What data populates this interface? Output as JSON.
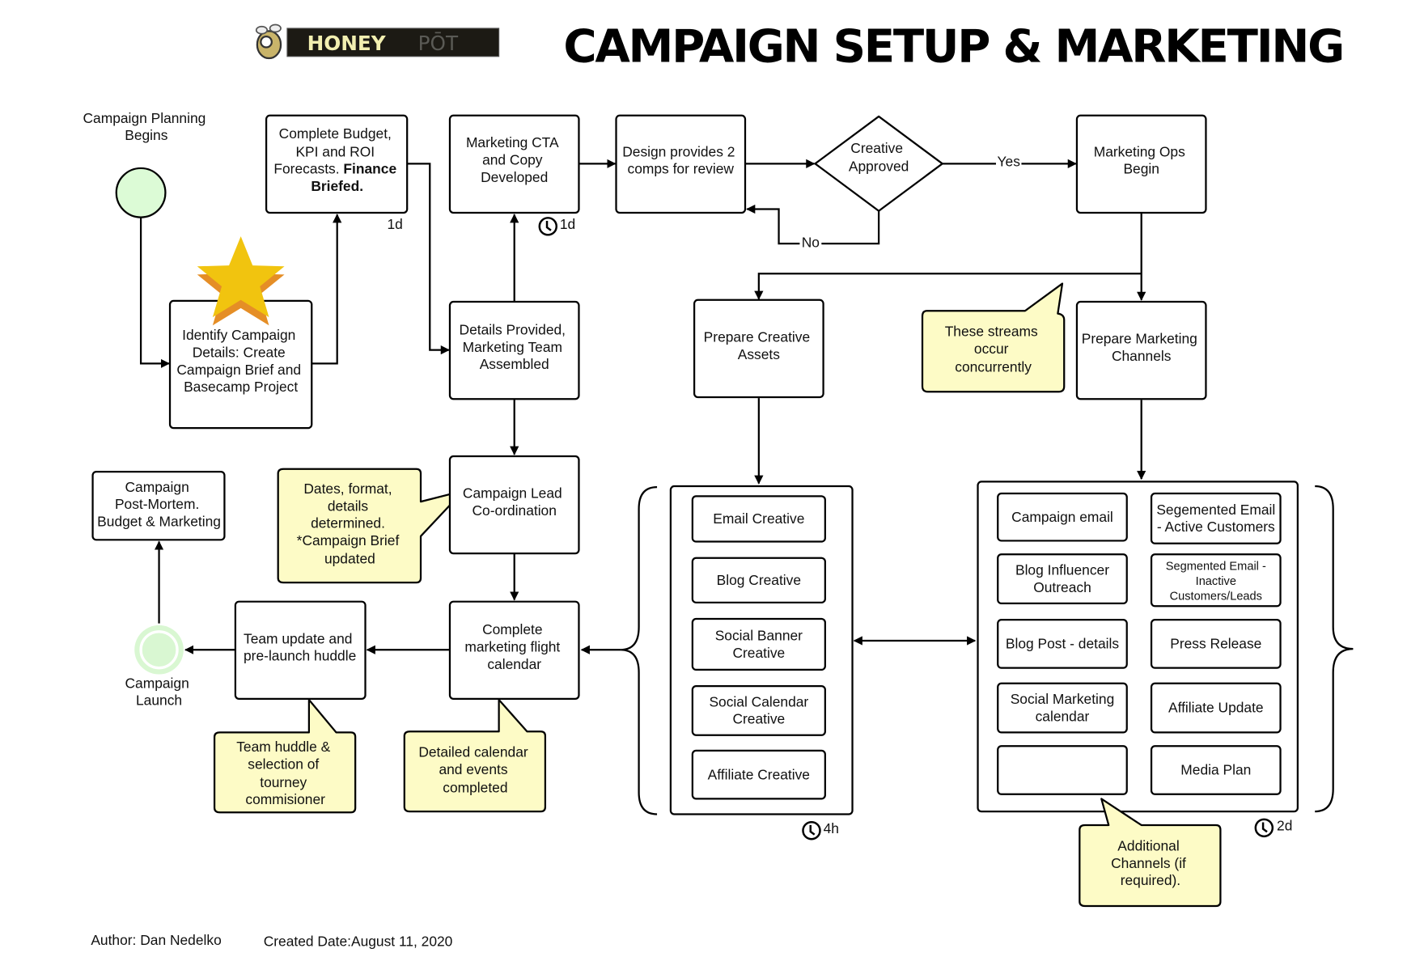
{
  "header": {
    "logo_text_bold": "HONEY",
    "logo_text_light": "PŌT",
    "title": "CAMPAIGN SETUP & MARKETING"
  },
  "colors": {
    "note_fill": "#fdfbc6",
    "start_circle_fill": "#dcfbd6",
    "end_circle_fill": "#d9f7d2",
    "star_fill": "#f1c40f",
    "star_shadow": "#e58e26"
  },
  "nodes": {
    "start": {
      "label": [
        "Campaign Planning",
        "Begins"
      ],
      "icon": "start-circle"
    },
    "identify": {
      "label": [
        "Identify Campaign",
        "Details: Create",
        "Campaign Brief and",
        "Basecamp Project"
      ],
      "icon": "star-icon"
    },
    "budget": {
      "label": [
        "Complete Budget,",
        "KPI and ROI"
      ],
      "label_line3_regular": "Forecasts.",
      "label_line3_bold": "Finance",
      "label_line4_bold": "Briefed.",
      "duration": "1d"
    },
    "cta": {
      "label": [
        "Marketing CTA",
        "and Copy",
        "Developed"
      ],
      "duration": "1d"
    },
    "design": {
      "label": [
        "Design provides 2",
        "comps for review"
      ]
    },
    "decision": {
      "label": [
        "Creative",
        "Approved"
      ],
      "yes_label": "Yes",
      "no_label": "No"
    },
    "ops": {
      "label": [
        "Marketing Ops",
        "Begin"
      ]
    },
    "details": {
      "label": [
        "Details Provided,",
        "Marketing Team",
        "Assembled"
      ]
    },
    "creative_assets": {
      "label": [
        "Prepare Creative",
        "Assets"
      ]
    },
    "channels": {
      "label": [
        "Prepare Marketing",
        "Channels"
      ]
    },
    "lead": {
      "label": [
        "Campaign Lead",
        "Co-ordination"
      ]
    },
    "flight": {
      "label": [
        "Complete",
        "marketing flight",
        "calendar"
      ]
    },
    "huddle": {
      "label": [
        "Team update and",
        "pre-launch huddle"
      ]
    },
    "launch": {
      "label": [
        "Campaign",
        "Launch"
      ]
    },
    "postmortem": {
      "label": [
        "Campaign",
        "Post-Mortem.",
        "Budget & Marketing"
      ]
    }
  },
  "creative_group": {
    "duration": "4h",
    "items": [
      [
        "Email Creative"
      ],
      [
        "Blog Creative"
      ],
      [
        "Social Banner",
        "Creative"
      ],
      [
        "Social Calendar",
        "Creative"
      ],
      [
        "Affiliate Creative"
      ]
    ]
  },
  "channel_group": {
    "duration": "2d",
    "left_items": [
      [
        "Campaign email"
      ],
      [
        "Blog Influencer",
        "Outreach"
      ],
      [
        "Blog Post - details"
      ],
      [
        "Social Marketing",
        "calendar"
      ],
      [
        ""
      ]
    ],
    "right_items": [
      [
        "Segemented Email",
        "- Active Customers"
      ],
      [
        "Segmented Email -",
        "Inactive",
        "Customers/Leads"
      ],
      [
        "Press Release"
      ],
      [
        "Affiliate Update"
      ],
      [
        "Media Plan"
      ]
    ]
  },
  "notes": {
    "concurrent": [
      "These streams",
      "occur",
      "concurrently"
    ],
    "dates": [
      "Dates, format,",
      "details",
      "determined.",
      "*Campaign Brief",
      "updated"
    ],
    "team_huddle": [
      "Team huddle &",
      "selection of",
      "tourney",
      "commisioner"
    ],
    "calendar": [
      "Detailed calendar",
      "and events",
      "completed"
    ],
    "additional": [
      "Additional",
      "Channels (if",
      "required)."
    ]
  },
  "footer": {
    "author": "Author: Dan Nedelko",
    "created": "Created Date:August 11, 2020"
  }
}
